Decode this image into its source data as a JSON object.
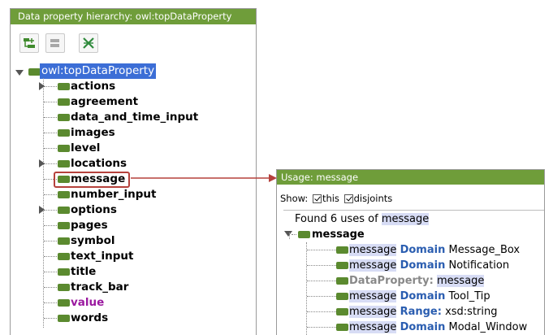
{
  "left_panel": {
    "title": "Data property hierarchy: owl:topDataProperty",
    "toolbar": [
      {
        "name": "add-subproperty-button",
        "icon": "add-subproperty-icon"
      },
      {
        "name": "add-sibling-button",
        "icon": "add-sibling-icon"
      },
      {
        "name": "delete-property-button",
        "icon": "delete-icon"
      }
    ],
    "root": "owl:topDataProperty",
    "items": [
      {
        "label": "actions",
        "expandable": true
      },
      {
        "label": "agreement",
        "expandable": false
      },
      {
        "label": "data_and_time_input",
        "expandable": false
      },
      {
        "label": "images",
        "expandable": false
      },
      {
        "label": "level",
        "expandable": false
      },
      {
        "label": "locations",
        "expandable": true
      },
      {
        "label": "message",
        "expandable": false,
        "highlighted": true
      },
      {
        "label": "number_input",
        "expandable": false
      },
      {
        "label": "options",
        "expandable": true
      },
      {
        "label": "pages",
        "expandable": false
      },
      {
        "label": "symbol",
        "expandable": false
      },
      {
        "label": "text_input",
        "expandable": false
      },
      {
        "label": "title",
        "expandable": false
      },
      {
        "label": "track_bar",
        "expandable": false
      },
      {
        "label": "value",
        "expandable": false,
        "color": "#9b1aa0"
      },
      {
        "label": "words",
        "expandable": false
      }
    ]
  },
  "usage_panel": {
    "title": "Usage: message",
    "show_label": "Show:",
    "checkboxes": [
      {
        "label": "this",
        "checked": true
      },
      {
        "label": "disjoints",
        "checked": true
      }
    ],
    "found_prefix": "Found 6 uses of",
    "found_term": "message",
    "root": "message",
    "uses": [
      {
        "subject": "message",
        "keyword": "Domain",
        "object": "Message_Box"
      },
      {
        "subject": "message",
        "keyword": "Domain",
        "object": "Notification"
      },
      {
        "subject": "",
        "keyword": "DataProperty:",
        "object": "message",
        "greyed": true
      },
      {
        "subject": "message",
        "keyword": "Domain",
        "object": "Tool_Tip"
      },
      {
        "subject": "message",
        "keyword": "Range:",
        "object": "xsd:string"
      },
      {
        "subject": "message",
        "keyword": "Domain",
        "object": "Modal_Window"
      }
    ]
  },
  "colors": {
    "title_bar": "#6f9d3a",
    "bullet": "#5b8a2f",
    "selection": "#3c6ed6",
    "highlight_box": "#b5413c",
    "keyword": "#2a5db0"
  }
}
